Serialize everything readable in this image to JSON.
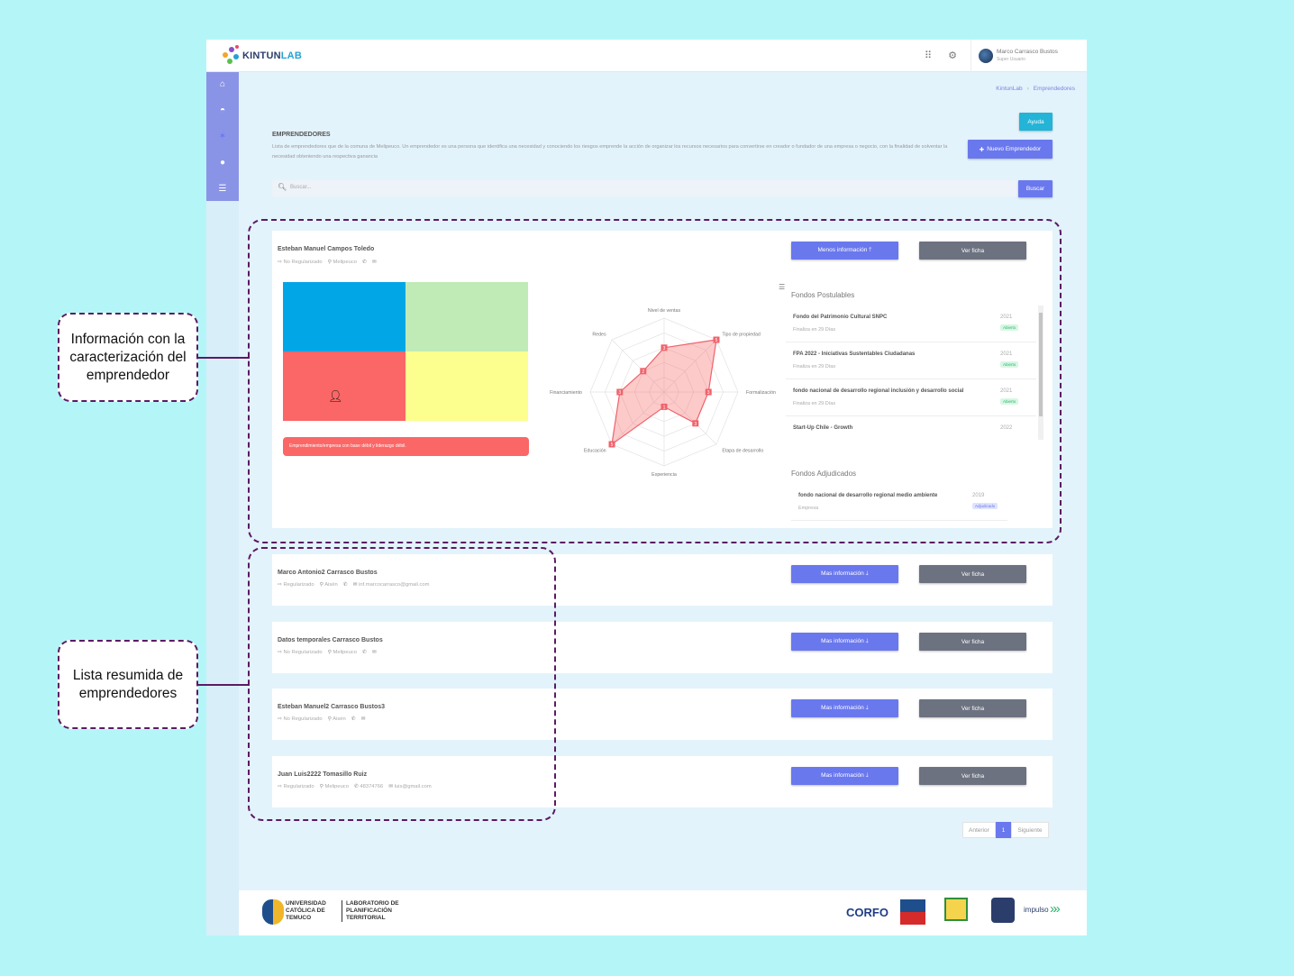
{
  "header": {
    "logo_text_a": "KINTUN",
    "logo_text_b": "LAB",
    "user_name": "Marco Carrasco Bustos",
    "user_role": "Super Usuario",
    "grid_icon": "apps-grid-icon",
    "settings_icon": "gear-icon"
  },
  "sidebar": {
    "items": [
      {
        "icon": "home-icon",
        "glyph": "⌂"
      },
      {
        "icon": "dashboard-icon",
        "glyph": "◓"
      },
      {
        "icon": "network-icon",
        "glyph": "✶"
      },
      {
        "icon": "map-pin-icon",
        "glyph": "●"
      },
      {
        "icon": "list-icon",
        "glyph": "☰"
      }
    ]
  },
  "breadcrumb": {
    "root": "KintunLab",
    "current": "Emprendedores"
  },
  "actions": {
    "help": "Ayuda",
    "new": "Nuevo Emprendedor",
    "search_button": "Buscar",
    "search_placeholder": "Buscar..."
  },
  "page": {
    "title": "EMPRENDEDORES",
    "description": "Lista de emprendedores que de la comuna de Melipeuco. Un emprendedor es una persona que identifica una necesidad y conociendo los riesgos emprende la acción de organizar los recursos necesarios para convertirse en creador o fundador de una empresa o negocio, con la finalidad de solventar la necesidad obteniendo una respectiva ganancia"
  },
  "expanded": {
    "name": "Esteban Manuel Campos Toledo",
    "status": "No Regularizado",
    "location": "Melipeuco",
    "btn_less": "Menos información 🡑",
    "btn_ficha": "Ver ficha",
    "quadrant_badge": "Emprendimiento/empresa con base débil y liderazgo débil.",
    "radar_labels": [
      "Nivel de ventas",
      "Tipo de propiedad",
      "Formalización",
      "Etapa de desarrollo",
      "Experiencia",
      "Educación",
      "Financiamiento",
      "Redes"
    ],
    "radar_values": [
      3,
      5,
      3,
      3,
      1,
      5,
      3,
      2
    ],
    "fondos_title": "Fondos Postulables",
    "fondos": [
      {
        "name": "Fondo del Patrimonio Cultural SNPC",
        "sub": "Finaliza en 29 Días",
        "year": "2021",
        "tag": "Abierto"
      },
      {
        "name": "FPA 2022 - Iniciativas Sustentables Ciudadanas",
        "sub": "Finaliza en 29 Días",
        "year": "2021",
        "tag": "Abierto"
      },
      {
        "name": "fondo nacional de desarrollo regional inclusión y desarrollo social",
        "sub": "Finaliza en 29 Días",
        "year": "2021",
        "tag": "Abierto"
      },
      {
        "name": "Start-Up Chile - Growth",
        "sub": "",
        "year": "2022",
        "tag": ""
      }
    ],
    "adjudicados_title": "Fondos Adjudicados",
    "adjudicados": [
      {
        "name": "fondo nacional de desarrollo regional medio ambiente",
        "sub": "Empresa",
        "year": "2019",
        "tag": "Adjudicado"
      }
    ]
  },
  "rows": [
    {
      "name": "Marco Antonio2 Carrasco Bustos",
      "status": "Regularizado",
      "location": "Aisén",
      "phone": "",
      "email": "inf.marcocarrasco@gmail.com",
      "more": "Mas información 🡓",
      "ficha": "Ver ficha"
    },
    {
      "name": "Datos temporales Carrasco Bustos",
      "status": "No Regularizado",
      "location": "Melipeuco",
      "phone": "",
      "email": "",
      "more": "Mas información 🡓",
      "ficha": "Ver ficha"
    },
    {
      "name": "Esteban Manuel2 Carrasco Bustos3",
      "status": "No Regularizado",
      "location": "Aisén",
      "phone": "",
      "email": "",
      "more": "Mas información 🡓",
      "ficha": "Ver ficha"
    },
    {
      "name": "Juan Luis2222 Tomasillo Ruiz",
      "status": "Regularizado",
      "location": "Melipeuco",
      "phone": "48374766",
      "email": "luis@gmail.com",
      "more": "Mas información 🡓",
      "ficha": "Ver ficha"
    }
  ],
  "pagination": {
    "prev": "Anterior",
    "page": "1",
    "next": "Siguiente"
  },
  "footer": {
    "uct": "UNIVERSIDAD\nCATÓLICA DE\nTEMUCO",
    "lab": "LABORATORIO DE\nPLANIFICACIÓN\nTERRITORIAL",
    "corfo": "CORFO",
    "impulso": "impulso"
  },
  "callouts": {
    "info": "Información con la caracterización del emprendedor",
    "list": "Lista resumida de emprendedores"
  },
  "colors": {
    "indigo": "#6a78ee",
    "cyan": "#23b4d7",
    "gray": "#6c7280",
    "annotation": "#5c1a63",
    "quad_blue": "#00a6e5",
    "quad_green": "#c0ebb6",
    "quad_red": "#fa6766",
    "quad_yellow": "#fcfe8e"
  }
}
